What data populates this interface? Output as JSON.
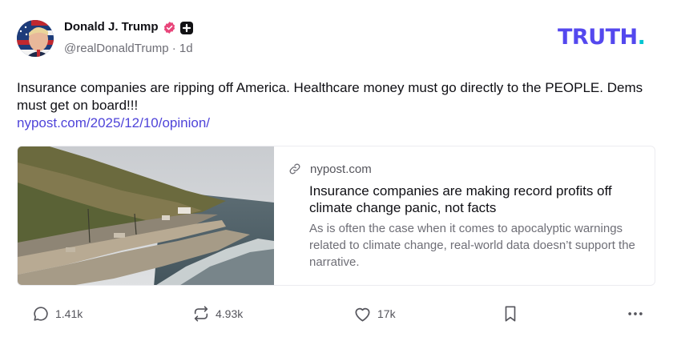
{
  "author": {
    "name": "Donald J. Trump",
    "handle": "@realDonaldTrump",
    "separator": "·",
    "age": "1d"
  },
  "brand": {
    "logo_text": "TRUTH",
    "logo_dot": ".",
    "color": "#5448ee",
    "dot_color": "#00c5d1"
  },
  "post": {
    "text": "Insurance companies are ripping off America. Healthcare money must go directly to the PEOPLE. Dems must get on board!!!",
    "link": "nypost.com/2025/12/10/opinion/"
  },
  "card": {
    "domain": "nypost.com",
    "title": "Insurance companies are making record profits off climate change panic, not facts",
    "description": "As is often the case when it comes to apocalyptic warnings related to climate change, real-world data doesn’t support the narrative."
  },
  "actions": {
    "replies": "1.41k",
    "retruths": "4.93k",
    "likes": "17k"
  },
  "icons": {
    "verified": "verified-badge-icon",
    "plus": "plus-badge-icon",
    "link": "link-icon",
    "reply": "comment-icon",
    "retruth": "repost-icon",
    "like": "heart-icon",
    "bookmark": "bookmark-icon",
    "more": "more-icon"
  },
  "colors": {
    "verified": "#e8457a",
    "link": "#4f44d9"
  }
}
